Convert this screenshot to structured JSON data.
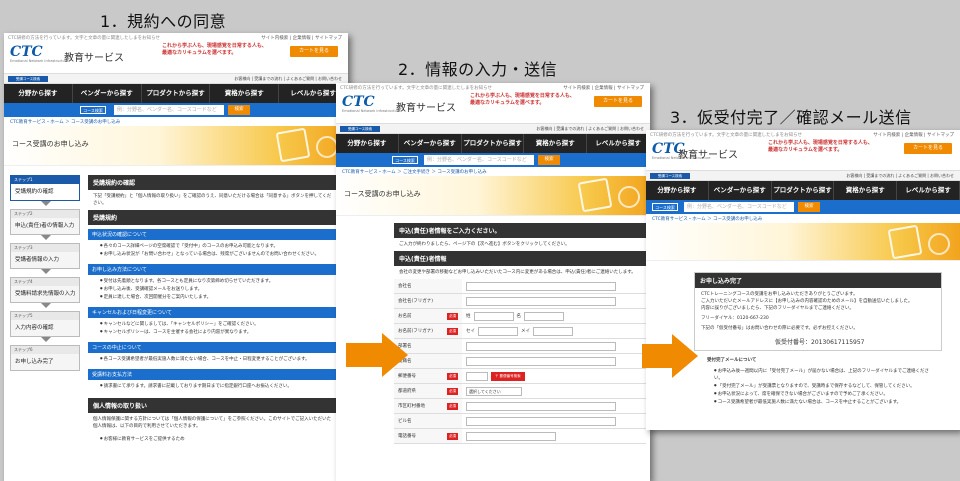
{
  "steps": {
    "step1": "1．規約への同意",
    "step2": "2．情報の入力・送信",
    "step3": "3．仮受付完了／確認メール送信"
  },
  "site": {
    "note": "CTC研修の方法を行っています。文字と文章の量に関連したしまをお知らせ",
    "top_links": "サイト内検索 | 企業情報 | サイトマップ",
    "logo": "CTC",
    "logo_sub": "Emotional Network Infrastructure",
    "title": "教育サービス",
    "catch1": "これから学ぶ人も、現場感覚を日常する人も、",
    "catch2": "最適なカリキュラムを選べます。",
    "cart": "カートを見る",
    "subnav_label": "受講コース検索",
    "subnav_links": "お客様向 | 受講までの流れ | よくあるご質問 | お問い合わせ",
    "nav": [
      "分野から探す",
      "ベンダーから探す",
      "プロダクトから探す",
      "資格から探す",
      "レベルから探す"
    ],
    "search_label": "コース検索",
    "search_placeholder": "例：分野名、ベンダー名、コースコードなど",
    "search_button": "検索"
  },
  "page1": {
    "crumb": "CTC教育サービス・ホーム ＞ コース受講のお申し込み",
    "banner_title": "コース受講のお申し込み",
    "flow": [
      {
        "num": "ステップ1",
        "label": "受講規約の確認"
      },
      {
        "num": "ステップ2",
        "label": "申込(責任)者の情報入力"
      },
      {
        "num": "ステップ3",
        "label": "受講者情報の入力"
      },
      {
        "num": "ステップ4",
        "label": "受講料請求先情報の入力"
      },
      {
        "num": "ステップ5",
        "label": "入力内容の確認"
      },
      {
        "num": "ステップ6",
        "label": "お申し込み完了"
      }
    ],
    "sec1_title": "受講規約の確認",
    "sec1_text": "下記「受講規約」と「個人情報の取り扱い」をご確認のうえ、同意いただける場合は「同意する」ボタンを押してください。",
    "sec2_title": "受講規約",
    "b1": "申込状況の確認について",
    "b1_items": [
      "各々のコース詳細ページの空席確認で「受付中」のコースのお申込み可能となります。",
      "お申し込み状況が「お問い合わせ」となっている場合は、残席がございませんのでお問い合わせください。"
    ],
    "b2": "お申し込み方法について",
    "b2_items": [
      "受付は先着順となります。各コースとも定員になり次第締め切らせていただきます。",
      "お申し込み後、受講確認メールをお送りします。",
      "定員に達した場合、次回開催分をご案内いたします。"
    ],
    "b3": "キャンセルおよび日程変更について",
    "b3_items": [
      "キャンセルなどに関しましては、「キャンセルポリシー」をご確認ください。",
      "キャンセルポリシーは、コースを主催する会社により内容が異なります。"
    ],
    "cancel_link": "キャンセルポリシー",
    "b4": "コースの中止について",
    "b4_items": [
      "各コース受講希望者が最低実施人数に満たない場合、コースを中止・日程変更することがございます。"
    ],
    "b5": "受講料お支払方法",
    "b5_items": [
      "請求書にて承ります。請求書に記載しております期日までに指定銀行口座へお振込ください。"
    ],
    "sec3_title": "個人情報の取り扱い",
    "sec3_text": "個人情報保護に関する方針については「個人情報の保護について」をご参照ください。このサイトでご記入いただいた個人情報は、以下の目的で利用させていただきます。",
    "sec3_item": "お客様に教育サービスをご提供するため"
  },
  "page2": {
    "crumb": "CTC教育サービス・ホーム ＞ ご注文手続き ＞ コース受講のお申し込み",
    "sec_title": "申込(責任)者情報をご入力ください。",
    "sec_text": "ご入力が終わりましたら、ページ下の【次へ進む】ボタンをクリックしてください。",
    "form_title": "申込(責任)者情報",
    "form_note": "会社の変更や部署の移動などお申し込みいただいたコース内に変更がある場合は、申込(責任)者にご連絡いたします。",
    "fields": [
      {
        "label": "会社名",
        "req": false
      },
      {
        "label": "会社名(フリガナ)",
        "req": false
      },
      {
        "label": "お名前",
        "req": true,
        "a": "姓",
        "b": "名"
      },
      {
        "label": "お名前(フリガナ)",
        "req": true,
        "a": "セイ",
        "b": "メイ"
      },
      {
        "label": "部署名",
        "req": false
      },
      {
        "label": "役職名",
        "req": false
      },
      {
        "label": "郵便番号",
        "req": true
      },
      {
        "label": "都道府県",
        "req": true
      },
      {
        "label": "市区町村番地",
        "req": true
      },
      {
        "label": "ビル名",
        "req": false
      },
      {
        "label": "電話番号",
        "req": true
      }
    ],
    "zip_button": "〒 郵便番号検索",
    "pref_select": "選択してください"
  },
  "page3": {
    "crumb": "CTC教育サービス・ホーム ＞ コース受講のお申し込み",
    "box_title": "お申し込み完了",
    "text1": "CTCトレーニングコースの受講をお申し込みいただきありがとうございます。",
    "text2": "ご入力いただいたメールアドレスに【お申し込みの内容確認のためのメール】を自動送信いたしました。",
    "text3": "内容に誤りがございましたら、下記のフリーダイヤルまでご連絡ください。",
    "freedial_label": "フリーダイヤル：",
    "freedial": "0120-667-230",
    "text4": "下記の「仮受付番号」はお問い合わせの際に必要です。必ずお控えください。",
    "receipt_label": "仮受付番号：",
    "receipt_no": "20130617115957",
    "mail_title": "受付完了メールについて",
    "mail_items": [
      "お申込み後一週間以内に「受付完了メール」が届かない場合は、上記のフリーダイヤルまでご連絡ください。",
      "「受付完了メール」が受講票となりますので、受講時まで保存するなどして、保管してください。",
      "お申込状況によって、席を確保できない場合がございますので予めご了承ください。",
      "コース受講希望者が最低実施人数に満たない場合は、コースを中止することがございます。"
    ]
  }
}
